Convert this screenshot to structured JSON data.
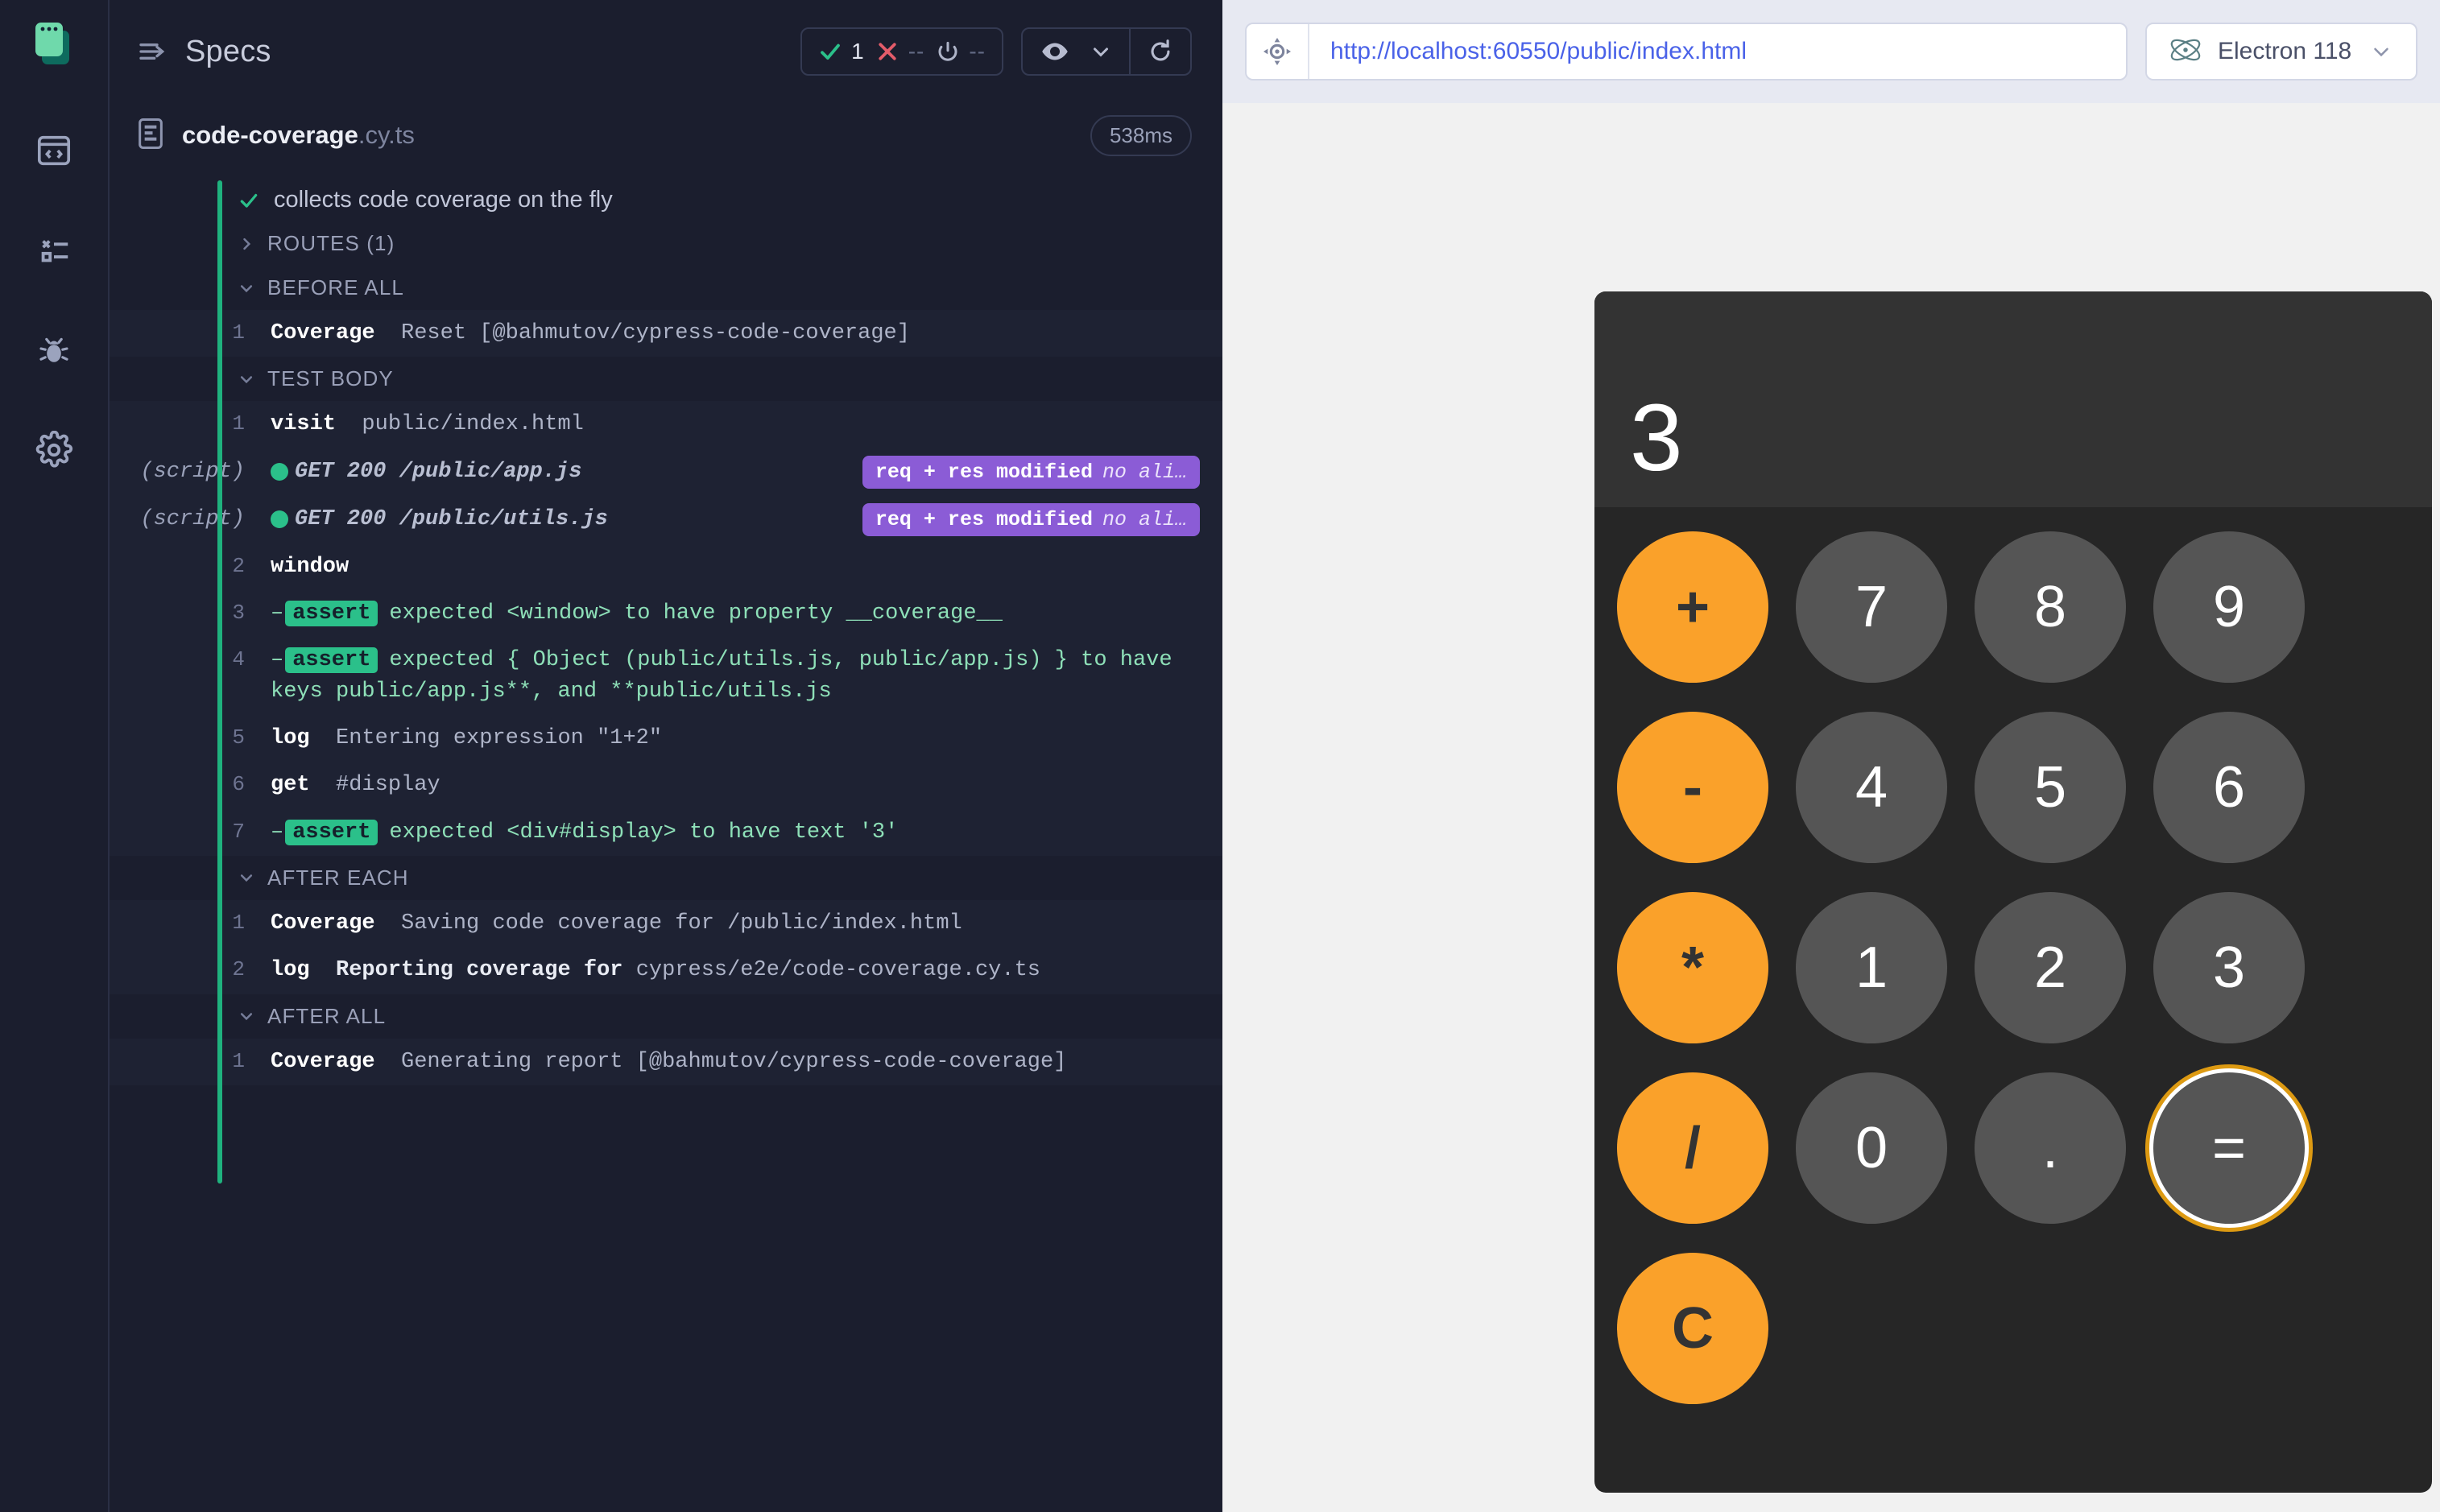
{
  "sidebar": {
    "logo_name": "cypress-logo",
    "items": [
      {
        "name": "specs",
        "icon": "code-window-icon"
      },
      {
        "name": "runs",
        "icon": "runs-list-icon"
      },
      {
        "name": "debug",
        "icon": "bug-icon"
      },
      {
        "name": "settings",
        "icon": "gear-icon"
      }
    ]
  },
  "reporter": {
    "title": "Specs",
    "stats": {
      "passed_label": "1",
      "failed_label": "--",
      "pending_label": "--"
    },
    "controls": {
      "eye": "eye-icon",
      "chevron": "chevron-down-icon",
      "reload": "reload-icon"
    },
    "spec": {
      "name": "code-coverage",
      "extension": ".cy.ts",
      "duration": "538ms"
    },
    "test": {
      "title": "collects code coverage on the fly"
    },
    "routes_group": {
      "label": "ROUTES (1)",
      "expanded": false
    },
    "groups": [
      {
        "label": "BEFORE ALL",
        "expanded": true,
        "commands": [
          {
            "num": "1",
            "name": "Coverage",
            "message": "Reset [@bahmutov/cypress-code-coverage]"
          }
        ]
      },
      {
        "label": "TEST BODY",
        "expanded": true,
        "commands": [
          {
            "num": "1",
            "name": "visit",
            "message": "public/index.html"
          },
          {
            "type": "route",
            "label": "(script)",
            "text": "GET 200 /public/app.js",
            "badge_bold": "req + res modified",
            "badge_italic": "no ali…"
          },
          {
            "type": "route",
            "label": "(script)",
            "text": "GET 200 /public/utils.js",
            "badge_bold": "req + res modified",
            "badge_italic": "no ali…"
          },
          {
            "num": "2",
            "name": "window",
            "message": ""
          },
          {
            "num": "3",
            "type": "assert",
            "badge": "assert",
            "message": "expected <window> to have property __coverage__"
          },
          {
            "num": "4",
            "type": "assert",
            "badge": "assert",
            "message": "expected { Object (public/utils.js, public/app.js) } to have keys public/app.js**, and **public/utils.js"
          },
          {
            "num": "5",
            "name": "log",
            "message": "Entering expression \"1+2\""
          },
          {
            "num": "6",
            "name": "get",
            "message": "#display"
          },
          {
            "num": "7",
            "type": "assert",
            "badge": "assert",
            "message": "expected <div#display> to have text '3'"
          }
        ]
      },
      {
        "label": "AFTER EACH",
        "expanded": true,
        "commands": [
          {
            "num": "1",
            "name": "Coverage",
            "message": "Saving code coverage for /public/index.html"
          },
          {
            "num": "2",
            "name": "log",
            "message_strong": "Reporting coverage for",
            "message": "cypress/e2e/code-coverage.cy.ts"
          }
        ]
      },
      {
        "label": "AFTER ALL",
        "expanded": true,
        "commands": [
          {
            "num": "1",
            "name": "Coverage",
            "message": "Generating report [@bahmutov/cypress-code-coverage]"
          }
        ]
      }
    ]
  },
  "aut": {
    "url": "http://localhost:60550/public/index.html",
    "selector_icon": "selector-crosshair-icon",
    "browser": {
      "name": "Electron 118",
      "icon": "electron-icon"
    }
  },
  "calculator": {
    "display": "3",
    "rows": [
      [
        {
          "label": "+",
          "kind": "op"
        },
        {
          "label": "7",
          "kind": "num"
        },
        {
          "label": "8",
          "kind": "num"
        },
        {
          "label": "9",
          "kind": "num"
        }
      ],
      [
        {
          "label": "-",
          "kind": "op"
        },
        {
          "label": "4",
          "kind": "num"
        },
        {
          "label": "5",
          "kind": "num"
        },
        {
          "label": "6",
          "kind": "num"
        }
      ],
      [
        {
          "label": "*",
          "kind": "op"
        },
        {
          "label": "1",
          "kind": "num"
        },
        {
          "label": "2",
          "kind": "num"
        },
        {
          "label": "3",
          "kind": "num"
        }
      ],
      [
        {
          "label": "/",
          "kind": "op"
        },
        {
          "label": "0",
          "kind": "num"
        },
        {
          "label": ".",
          "kind": "num"
        },
        {
          "label": "=",
          "kind": "num",
          "highlighted": true
        }
      ],
      [
        {
          "label": "C",
          "kind": "op"
        }
      ]
    ]
  },
  "colors": {
    "accent_green": "#2bc08a",
    "accent_red": "#e45c6a",
    "intercept_purple": "#8b5cd6",
    "calc_orange": "#faa12a",
    "highlight_orange": "#dd9a12",
    "url_blue": "#4a62e8"
  }
}
